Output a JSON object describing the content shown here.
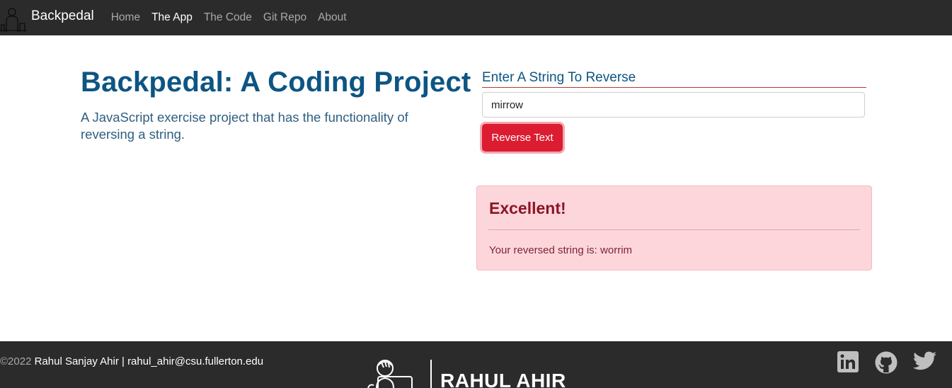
{
  "nav": {
    "brand": "Backpedal",
    "links": [
      {
        "label": "Home",
        "active": false
      },
      {
        "label": "The App",
        "active": true
      },
      {
        "label": "The Code",
        "active": false
      },
      {
        "label": "Git Repo",
        "active": false
      },
      {
        "label": "About",
        "active": false
      }
    ]
  },
  "hero": {
    "title": "Backpedal: A Coding Project",
    "subtitle": "A JavaScript exercise project that has the functionality of reversing a string."
  },
  "form": {
    "label": "Enter A String To Reverse",
    "input_value": "mirrow",
    "button_label": "Reverse Text"
  },
  "alert": {
    "heading": "Excellent!",
    "text_prefix": "Your reversed string is: ",
    "result": "worrim"
  },
  "footer": {
    "copyright_symbol_year": "©2022",
    "owner": "Rahul Sanjay Ahir | rahul_ahir@csu.fullerton.edu",
    "logo_text": "RAHUL AHIR",
    "social": [
      "linkedin-icon",
      "github-icon",
      "twitter-icon"
    ]
  },
  "colors": {
    "nav_bg": "#2b2b2b",
    "title": "#0d5582",
    "button": "#dc1c30",
    "alert_bg": "#fdd6dc",
    "alert_text": "#8a1624"
  }
}
